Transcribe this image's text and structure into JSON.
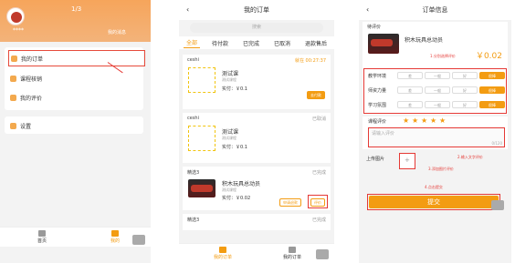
{
  "profile": {
    "page_indicator": "1/3",
    "username": "****",
    "messages_label": "我的消息",
    "menu": [
      {
        "label": "我的订单"
      },
      {
        "label": "课程核销"
      },
      {
        "label": "我的评价"
      }
    ],
    "settings_label": "设置",
    "tabbar": [
      {
        "label": "首页"
      },
      {
        "label": "我的"
      }
    ]
  },
  "orders": {
    "title": "我的订单",
    "search_placeholder": "搜索",
    "tabs": [
      "全部",
      "待付款",
      "已完成",
      "已取消",
      "退款售后"
    ],
    "cards": [
      {
        "shop": "ceshi",
        "status": "就在 00:27:37",
        "name": "测试课",
        "sub": "测试课程",
        "pay": "实付：￥0.1",
        "button": "去付款"
      },
      {
        "shop": "ceshi",
        "status": "已取消",
        "name": "测试课",
        "sub": "测试课程",
        "pay": "实付：￥0.1",
        "button": ""
      },
      {
        "shop": "精选3",
        "status": "已完成",
        "name": "积木玩具总动员",
        "sub": "测试课程",
        "pay": "实付：￥0.02",
        "button_secondary": "申请退款",
        "button": "评价"
      },
      {
        "shop": "精选3",
        "status": "已完成"
      }
    ],
    "tabbar": [
      {
        "label": "我的订单"
      },
      {
        "label": "我的订单"
      }
    ]
  },
  "review": {
    "title": "订单信息",
    "section_label": "待评价",
    "product_name": "积木玩具总动员",
    "product_price": "￥0.02",
    "annotation_1": "1.分别选择评价",
    "rows": [
      {
        "label": "教学环境",
        "options": [
          "差",
          "一般",
          "好",
          "很棒"
        ]
      },
      {
        "label": "师资力量",
        "options": [
          "差",
          "一般",
          "好",
          "很棒"
        ]
      },
      {
        "label": "学习氛围",
        "options": [
          "差",
          "一般",
          "好",
          "很棒"
        ]
      }
    ],
    "overall_label": "课程评价",
    "stars": 5,
    "comment_placeholder": "请输入评价",
    "counter": "0/120",
    "annotation_2": "2.输入文字评价",
    "upload_label": "上传图片",
    "annotation_3": "3.添加图片评价",
    "annotation_4": "4.点击提交",
    "submit_label": "提交"
  }
}
